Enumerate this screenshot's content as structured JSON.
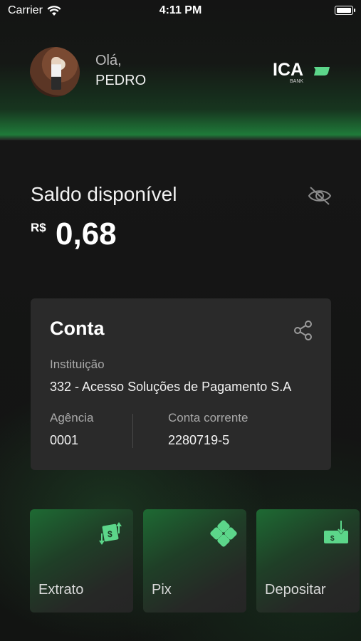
{
  "status_bar": {
    "carrier": "Carrier",
    "time": "4:11 PM"
  },
  "header": {
    "greeting": "Olá,",
    "user_name": "PEDRO",
    "logo_text": "ICA",
    "logo_subtext": "BANK"
  },
  "balance": {
    "label": "Saldo disponível",
    "currency": "R$",
    "amount": "0,68",
    "visibility_icon": "eye-off-icon"
  },
  "account_card": {
    "title": "Conta",
    "share_icon": "share-icon",
    "institution_label": "Instituição",
    "institution_value": "332 - Acesso Soluções de Pagamento S.A",
    "agency_label": "Agência",
    "agency_value": "0001",
    "account_label": "Conta corrente",
    "account_value": "2280719-5"
  },
  "actions": [
    {
      "label": "Extrato",
      "icon": "money-transfer-icon"
    },
    {
      "label": "Pix",
      "icon": "pix-icon"
    },
    {
      "label": "Depositar",
      "icon": "deposit-icon"
    }
  ],
  "colors": {
    "accent_green": "#5cd68a",
    "card_bg": "#2a2a2a",
    "background": "#151515"
  }
}
